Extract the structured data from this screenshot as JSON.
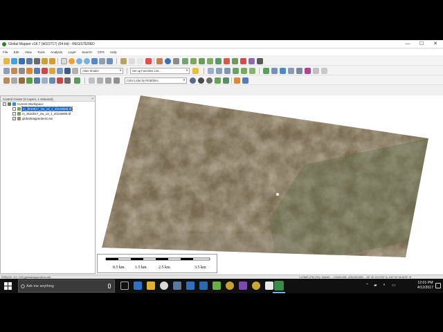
{
  "window": {
    "title": "Global Mapper v18.7 (b022717) (64-bit) - REGISTERED",
    "minimize": "—",
    "maximize": "☐",
    "close": "✕"
  },
  "menu": [
    "File",
    "Edit",
    "View",
    "Tools",
    "Analysis",
    "Layer",
    "Search",
    "GPS",
    "Help"
  ],
  "toolbars": {
    "shader_select": "Atlas Shader",
    "favorites_select": "Set up Favorites List...",
    "lidar_color_select": "Color Lidar by RGB/Elev"
  },
  "control_center": {
    "header": "Control Center (3 Layers, 1 Selected)",
    "close": "×",
    "workspace": "Current Workspace",
    "layers": [
      {
        "name": "m_3510517_nw_13_1_20140609.tif",
        "selected": true
      },
      {
        "name": "m_3510517_nw_13_1_20140609.tif",
        "selected": false
      },
      {
        "name": "globalmapperdemo.ssi",
        "selected": false
      }
    ]
  },
  "scalebar": {
    "ticks": [
      "0.5 km",
      "1.5 km",
      "2.5 km",
      "3.5 km"
    ]
  },
  "status": {
    "left": "RGB(120, 112, 100) (globalmapperdemo.ssi)",
    "right": "1:47880   UTM (TN) / NAD83 ... 175440.05E, 4251535.65N ... 35° 40' 15.2730\" N, 105° 53' 58.8193\" W"
  },
  "taskbar": {
    "search_placeholder": "Ask me anything",
    "time": "12:01 PM",
    "date": "4/12/2017"
  },
  "colors": {
    "selection": "#0a64d8",
    "taskbar": "#101010",
    "terrain_base": "#7a6c52"
  }
}
